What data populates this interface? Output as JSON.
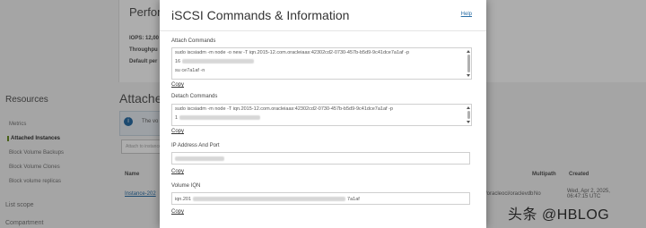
{
  "background": {
    "performance_title": "Perform",
    "perf_rows": [
      "IOPS: 12,00",
      "Throughpu",
      "Default per"
    ],
    "sidebar": {
      "heading": "Resources",
      "items": [
        "Metrics",
        "Attached Instances",
        "Block Volume Backups",
        "Block Volume Clones",
        "Block volume replicas"
      ],
      "active_index": 1,
      "footer_items": [
        "List scope",
        "Compartment"
      ]
    },
    "attached_title": "Attache",
    "info_text": "The vo",
    "filter_placeholder": "Attach to instance",
    "table_headers": [
      "Name",
      "Multipath",
      "Created"
    ],
    "table_row": {
      "name": "Instance-202",
      "path_cell": "/oracleoci/oraclevdb",
      "multipath": "No",
      "created": "Wed, Apr 2, 2025, 06:47:15 UTC"
    }
  },
  "modal": {
    "title": "iSCSI Commands & Information",
    "help": "Help",
    "attach_label": "Attach Commands",
    "attach_lines": [
      "sudo iscsiadm -m node -o new -T iqn.2015-12.com.oracleiaas:42302cd2-0730-457b-b5d9-9c41dce7a1af -p",
      "16",
      "su                                                                                          ce7a1af -n"
    ],
    "detach_label": "Detach Commands",
    "detach_lines": [
      "sudo iscsiadm -m node -T iqn.2015-12.com.oracleiaas:42302cd2-0730-457b-b5d9-9c41dce7a1af -p",
      "1"
    ],
    "ip_label": "IP Address And Port",
    "iqn_label": "Volume IQN",
    "iqn_value_start": "iqn.201",
    "iqn_value_end": "7a1af",
    "copy": "Copy"
  },
  "watermark": "头条 @HBLOG",
  "colors": {
    "link": "#2a6ea6",
    "overlay": "rgba(0,0,0,0.32)",
    "active_marker": "#6b8e23"
  }
}
